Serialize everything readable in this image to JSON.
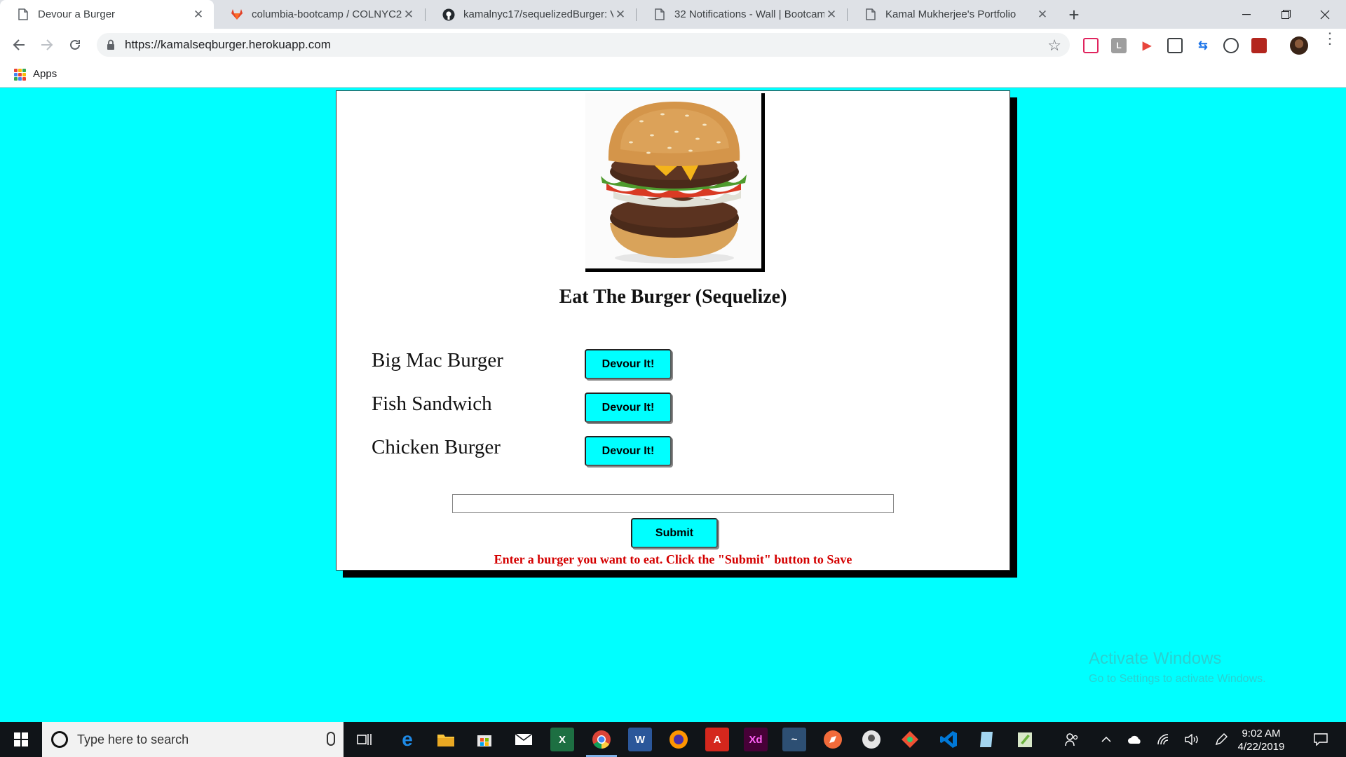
{
  "browser": {
    "tabs": [
      {
        "label": "Devour a Burger",
        "active": true,
        "icon": "page-icon"
      },
      {
        "label": "columbia-bootcamp / COLNYC20",
        "active": false,
        "icon": "gitlab-icon"
      },
      {
        "label": "kamalnyc17/sequelizedBurger: Vi",
        "active": false,
        "icon": "github-icon"
      },
      {
        "label": "32 Notifications - Wall | Bootcam",
        "active": false,
        "icon": "page-icon"
      },
      {
        "label": "Kamal Mukherjee's Portfolio",
        "active": false,
        "icon": "page-icon"
      }
    ],
    "url": "https://kamalseqburger.herokuapp.com",
    "bookmarks": {
      "apps_label": "Apps"
    }
  },
  "page": {
    "title": "Eat The Burger (Sequelize)",
    "burgers": [
      {
        "name": "Big Mac Burger",
        "button": "Devour It!"
      },
      {
        "name": "Fish Sandwich",
        "button": "Devour It!"
      },
      {
        "name": "Chicken Burger",
        "button": "Devour It!"
      }
    ],
    "input_value": "",
    "submit_label": "Submit",
    "hint": "Enter a burger you want to eat. Click the \"Submit\" button to Save",
    "background_color": "#00ffff",
    "hint_color": "#d40000"
  },
  "watermark": {
    "line1": "Activate Windows",
    "line2": "Go to Settings to activate Windows."
  },
  "taskbar": {
    "search_placeholder": "Type here to search",
    "time": "9:02 AM",
    "date": "4/22/2019"
  }
}
